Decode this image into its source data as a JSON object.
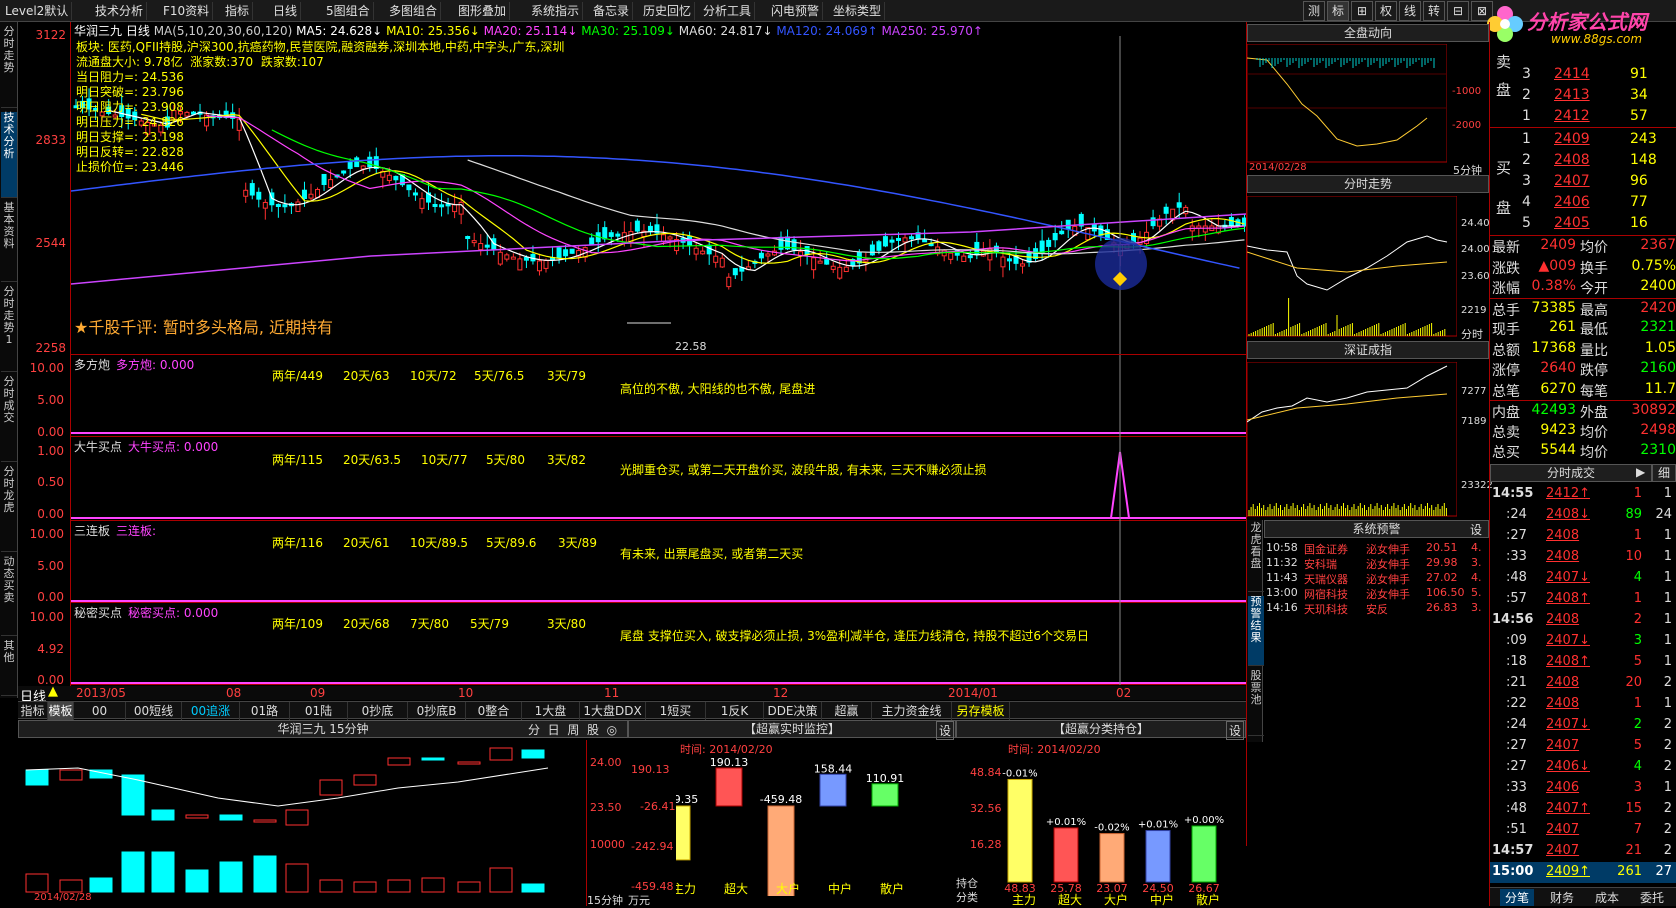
{
  "menu": {
    "items": [
      "Level2默认",
      "技术分析",
      "F10资料",
      "指标",
      "日线",
      "5图组合",
      "多图组合",
      "图形叠加",
      "系统指示",
      "备忘录",
      "历史回忆",
      "分析工具",
      "闪电预警",
      "坐标类型"
    ],
    "right": [
      "测",
      "标",
      "⊞",
      "权",
      "线",
      "转",
      "⊟",
      "⊠"
    ]
  },
  "logo": {
    "text": "分析家公式网",
    "url": "www.88gs.com"
  },
  "leftnav": [
    "分时走势",
    "技术分析",
    "基本资料",
    "分时走势1",
    "分时成交",
    "分时龙虎",
    "动态买卖",
    "其他"
  ],
  "main": {
    "titlebar": {
      "name": "华润三九",
      "period": "日线",
      "ma_spec": "MA(5,10,20,30,60,120)",
      "ma5": "MA5: 24.628↓",
      "ma10": "MA10: 25.356↓",
      "ma20": "MA20: 25.114↓",
      "ma30": "MA30: 25.109↓",
      "ma60": "MA60: 24.817↓",
      "ma120": "MA120: 24.069↑",
      "ma250": "MA250: 25.970↑"
    },
    "info": {
      "sector": "板块: 医药,QFII持股,沪深300,抗癌药物,民营医院,融资融券,深圳本地,中药,中字头,广东,深圳",
      "float": "流通盘大小: 9.78亿",
      "up": "涨家数:370",
      "down": "跌家数:107",
      "zl": "当日阻力=: 24.536",
      "tp": "明日突破=: 23.796",
      "r1": "明日阻力=: 23.908",
      "r2": "明日压力=: 24.826",
      "sp": "明日支撑=: 23.198",
      "fz": "明日反转=: 22.828",
      "stop": "止损价位=: 23.446",
      "low": "22.58",
      "comment": "★千股千评: 暂时多头格局, 近期持有"
    },
    "yaxis": [
      "3122",
      "2833",
      "2544",
      "2258"
    ],
    "panels": [
      {
        "title": "多方炮",
        "ind": "多方炮: 0.000",
        "y": [
          "10.00",
          "5.00",
          "0.00"
        ],
        "stats": [
          "两年/449",
          "20天/63",
          "10天/72",
          "5天/76.5",
          "3天/79"
        ],
        "note": "高位的不傲, 大阳线的也不傲, 尾盘进"
      },
      {
        "title": "大牛买点",
        "ind": "大牛买点: 0.000",
        "y": [
          "1.00",
          "0.50",
          "0.00"
        ],
        "stats": [
          "两年/115",
          "20天/63.5",
          "10天/77",
          "5天/80",
          "3天/82"
        ],
        "note": "光脚重仓买, 或第二天开盘价买, 波段牛股, 有未来, 三天不赚必须止损"
      },
      {
        "title": "三连板",
        "ind": "三连板:",
        "y": [
          "10.00",
          "5.00",
          "0.00"
        ],
        "stats": [
          "两年/116",
          "20天/61",
          "10天/89.5",
          "5天/89.6",
          "3天/89"
        ],
        "note": "有未来, 出票尾盘买, 或者第二天买"
      },
      {
        "title": "秘密买点",
        "ind": "秘密买点: 0.000",
        "y": [
          "10.00",
          "4.92",
          "0.00"
        ],
        "stats": [
          "两年/109",
          "20天/68",
          "7天/80",
          "5天/79",
          "3天/80"
        ],
        "note": "尾盘 支撑位买入, 破支撑必须止损, 3%盈利减半仓, 逢压力线清仓, 持股不超过6个交易日"
      }
    ],
    "dates": [
      "2013/05",
      "08",
      "09",
      "10",
      "11",
      "12",
      "2014/01",
      "02"
    ],
    "period_label": "日线",
    "tabs": [
      "指标",
      "模板",
      "00",
      "00短线",
      "00追涨",
      "01路",
      "01陆",
      "0抄底",
      "0抄底B",
      "0整合",
      "1大盘",
      "1大盘DDX",
      "1短买",
      "1反K",
      "DDE决策",
      "超赢",
      "主力资金线",
      "另存模板"
    ]
  },
  "mini": {
    "title": "华润三九 15分钟",
    "btns": [
      "分",
      "日",
      "周",
      "股",
      "◎"
    ],
    "y": [
      "24.00",
      "23.50",
      "10000"
    ],
    "foot": "2014/02/28",
    "unit1": "15分钟",
    "unit2": "万元"
  },
  "ctrl": {
    "title": "【超赢实时监控】",
    "set": "设",
    "time": "时间: 2014/02/20",
    "y": [
      "190.13",
      "-26.41",
      "-242.94",
      "-459.48"
    ],
    "bars": [
      {
        "label": "主力",
        "value": "-269.35"
      },
      {
        "label": "超大",
        "value": "190.13"
      },
      {
        "label": "大户",
        "value": "-459.48"
      },
      {
        "label": "中户",
        "value": "158.44"
      },
      {
        "label": "散户",
        "value": "110.91"
      }
    ]
  },
  "hold": {
    "title": "【超赢分类持仓】",
    "set": "设",
    "time": "时间: 2014/02/20",
    "y": [
      "48.84",
      "32.56",
      "16.28"
    ],
    "side": [
      "持仓",
      "分类"
    ],
    "bars": [
      {
        "label": "主力",
        "pct": "-0.01%",
        "value": "48.83"
      },
      {
        "label": "超大",
        "pct": "+0.01%",
        "value": "25.78"
      },
      {
        "label": "大户",
        "pct": "-0.02%",
        "value": "23.07"
      },
      {
        "label": "中户",
        "pct": "+0.01%",
        "value": "24.50"
      },
      {
        "label": "散户",
        "pct": "+0.00%",
        "value": "26.67"
      }
    ]
  },
  "mid": {
    "qpd": {
      "title": "全盘动向",
      "y": [
        "-1000",
        "-2000"
      ],
      "foot": "2014/02/28",
      "unit": "5分钟"
    },
    "fs": {
      "title": "分时走势",
      "y": [
        "24.40",
        "24.00",
        "23.60",
        "2219"
      ],
      "unit": "分时"
    },
    "sz": {
      "title": "深证成指",
      "y": [
        "7277",
        "7189",
        "23322"
      ]
    },
    "sidetabs": [
      "龙虎看盘",
      "预警结果",
      "股票池"
    ],
    "alert": {
      "title": "系统预警",
      "set": "设",
      "rows": [
        [
          "10:58",
          "国金证券",
          "泌女伸手",
          "20.51",
          "4."
        ],
        [
          "11:32",
          "安科瑞",
          "泌女伸手",
          "29.98",
          "3."
        ],
        [
          "11:43",
          "天瑞仪器",
          "泌女伸手",
          "27.02",
          "4."
        ],
        [
          "13:00",
          "网宿科技",
          "泌女伸手",
          "106.50",
          "5."
        ],
        [
          "14:16",
          "天玑科技",
          "安反",
          "26.83",
          "3."
        ]
      ]
    }
  },
  "order": {
    "sell": [
      {
        "l": "卖",
        "p": "2414",
        "v": "91"
      },
      {
        "l": "",
        "p": "2413",
        "v": "34"
      },
      {
        "l": "",
        "p": "2412",
        "v": "57"
      }
    ],
    "sell_idx": [
      "3",
      "2",
      "1"
    ],
    "sellside": [
      "卖",
      "盘"
    ],
    "buy_idx": [
      "1",
      "2",
      "3",
      "4",
      "5"
    ],
    "buyside": [
      "买",
      "盘"
    ],
    "buy": [
      {
        "p": "2409",
        "v": "243"
      },
      {
        "p": "2408",
        "v": "148"
      },
      {
        "p": "2407",
        "v": "96"
      },
      {
        "p": "2406",
        "v": "77"
      },
      {
        "p": "2405",
        "v": "16"
      }
    ]
  },
  "quote": [
    [
      "最新",
      "2409",
      "均价",
      "2367"
    ],
    [
      "涨跌",
      "▲009",
      "换手",
      "0.75%"
    ],
    [
      "涨幅",
      "0.38%",
      "今开",
      "2400"
    ],
    [
      "总手",
      "73385",
      "最高",
      "2420"
    ],
    [
      "现手",
      "261",
      "最低",
      "2321"
    ],
    [
      "总额",
      "17368",
      "量比",
      "1.05"
    ],
    [
      "涨停",
      "2640",
      "跌停",
      "2160"
    ],
    [
      "总笔",
      "6270",
      "每笔",
      "11.7"
    ],
    [
      "内盘",
      "42493",
      "外盘",
      "30892"
    ],
    [
      "总卖",
      "9423",
      "均价",
      "2498"
    ],
    [
      "总买",
      "5544",
      "均价",
      "2310"
    ]
  ],
  "ticks": {
    "title": "分时成交",
    "btn": "细",
    "rows": [
      [
        "14:55",
        "2412↑",
        "1",
        "1"
      ],
      [
        ":24",
        "2408↓",
        "89",
        "24"
      ],
      [
        ":27",
        "2408",
        "1",
        "1"
      ],
      [
        ":33",
        "2408",
        "10",
        "1"
      ],
      [
        ":48",
        "2407↓",
        "4",
        "1"
      ],
      [
        ":57",
        "2408↑",
        "1",
        "1"
      ],
      [
        "14:56",
        "2408",
        "2",
        "1"
      ],
      [
        ":09",
        "2407↓",
        "3",
        "1"
      ],
      [
        ":18",
        "2408↑",
        "5",
        "1"
      ],
      [
        ":21",
        "2408",
        "20",
        "2"
      ],
      [
        ":22",
        "2408",
        "1",
        "1"
      ],
      [
        ":24",
        "2407↓",
        "2",
        "2"
      ],
      [
        ":27",
        "2407",
        "5",
        "2"
      ],
      [
        ":27",
        "2406↓",
        "4",
        "2"
      ],
      [
        ":33",
        "2406",
        "3",
        "1"
      ],
      [
        ":48",
        "2407↑",
        "15",
        "2"
      ],
      [
        ":51",
        "2407",
        "7",
        "2"
      ],
      [
        "14:57",
        "2407",
        "21",
        "2"
      ],
      [
        "15:00",
        "2409↑",
        "261",
        "27"
      ]
    ]
  },
  "bottomtabs": [
    "分笔",
    "财务",
    "成本",
    "委托"
  ],
  "colors": {
    "up": "#ff3030",
    "down": "#00ffff",
    "yellow": "#ffff00",
    "grid": "#aa0000"
  }
}
